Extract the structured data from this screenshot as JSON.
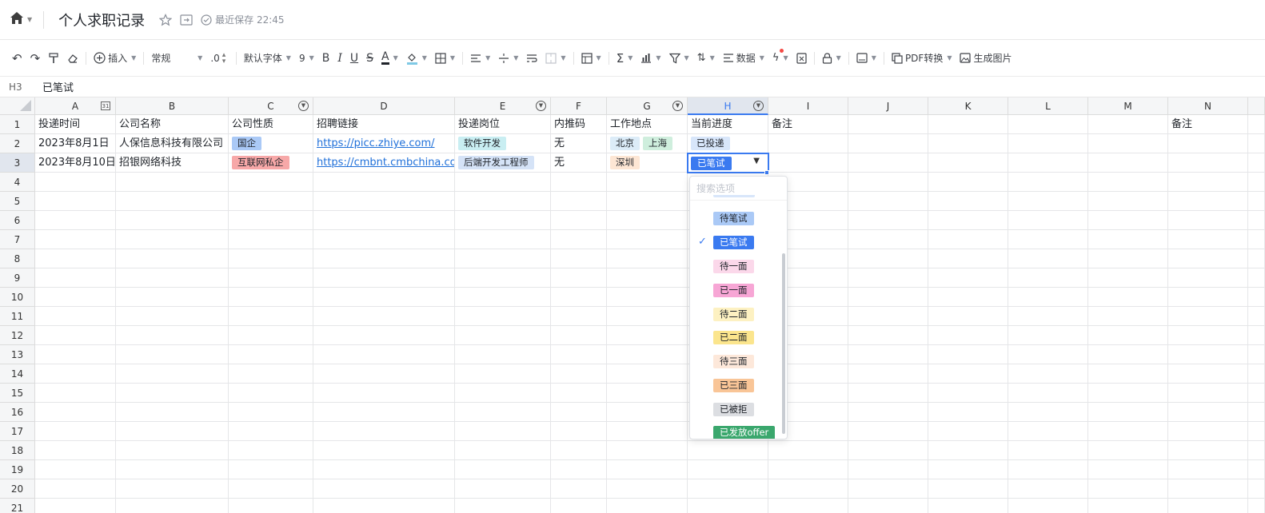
{
  "app": {
    "title": "个人求职记录",
    "save_status": "最近保存 22:45",
    "icons": {
      "home": "home-icon",
      "star": "star-icon",
      "move": "move-to-icon",
      "saved": "saved-check-icon"
    }
  },
  "toolbar": {
    "insert": "插入",
    "format": "常规",
    "decimal": ".0",
    "font": "默认字体",
    "font_size": "9",
    "data": "数据",
    "pdf": "PDF转换",
    "image": "生成图片"
  },
  "formula_bar": {
    "cell_ref": "H3",
    "value": "已笔试"
  },
  "columns": [
    "A",
    "B",
    "C",
    "D",
    "E",
    "F",
    "G",
    "H",
    "I",
    "J",
    "K",
    "L",
    "M",
    "N"
  ],
  "rows": [
    "1",
    "2",
    "3",
    "4",
    "5",
    "6",
    "7",
    "8",
    "9",
    "10",
    "11",
    "12",
    "13",
    "14",
    "15",
    "16",
    "17",
    "18",
    "19",
    "20",
    "21"
  ],
  "sheet": {
    "header": [
      "投递时间",
      "公司名称",
      "公司性质",
      "招聘链接",
      "投递岗位",
      "内推码",
      "工作地点",
      "当前进度",
      "备注",
      "备注"
    ],
    "row2": {
      "date": "2023年8月1日",
      "company": "人保信息科技有限公司",
      "type": "国企",
      "link": "https://picc.zhiye.com/",
      "position": "软件开发",
      "referral": "无",
      "loc1": "北京",
      "loc2": "上海",
      "progress": "已投递"
    },
    "row3": {
      "date": "2023年8月10日",
      "company": "招银网络科技",
      "type": "互联网私企",
      "link": "https://cmbnt.cmbchina.com/",
      "position": "后端开发工程师",
      "referral": "无",
      "loc1": "深圳",
      "progress": "已笔试"
    }
  },
  "dropdown": {
    "search_placeholder": "搜索选项",
    "options": [
      "待笔试",
      "已笔试",
      "待一面",
      "已一面",
      "待二面",
      "已二面",
      "待三面",
      "已三面",
      "已被拒",
      "已发放offer"
    ],
    "selected": "已笔试"
  },
  "colors": {
    "accent": "#3a7af0",
    "guo_qi": "#aac9f6",
    "hu_lian_wang": "#f7a8a8",
    "software": "#c9eef2",
    "backend": "#d5e3f7",
    "beijing": "#dcecf8",
    "shanghai": "#cfeedd",
    "shenzhen": "#fde6d4",
    "tou_di": "#d8e6fa"
  }
}
